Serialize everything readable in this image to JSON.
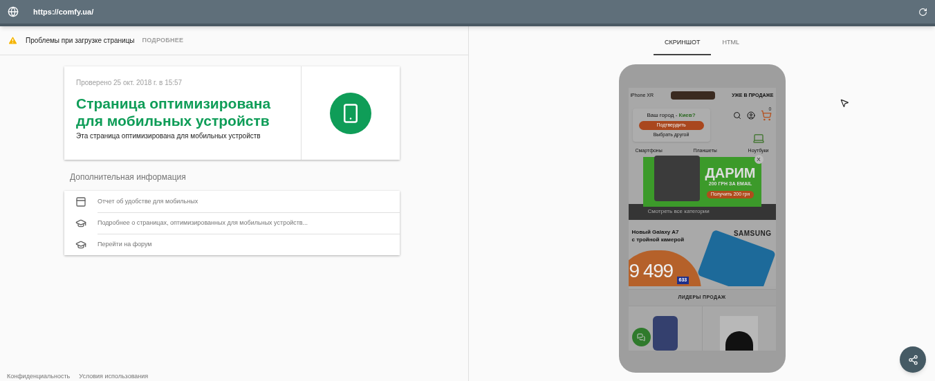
{
  "address_bar": {
    "url": "https://comfy.ua/"
  },
  "warning": {
    "text": "Проблемы при загрузке страницы",
    "link": "ПОДРОБНЕЕ"
  },
  "result_card": {
    "checked": "Проверено 25 окт. 2018 г. в 15:57",
    "title": "Страница оптимизирована для мобильных устройств",
    "description": "Эта страница оптимизирована для мобильных устройств"
  },
  "more_info": {
    "heading": "Дополнительная информация",
    "items": [
      {
        "kind": "report",
        "label": "Отчет об удобстве для мобильных"
      },
      {
        "kind": "learn",
        "label": "Подробнее о страницах, оптимизированных для мобильных устройств..."
      },
      {
        "kind": "learn",
        "label": "Перейти на форум"
      }
    ]
  },
  "footer_links": [
    "Конфиденциальность",
    "Условия использования"
  ],
  "tabs": [
    {
      "label": "СКРИНШОТ",
      "selected": true
    },
    {
      "label": "HTML",
      "selected": false
    }
  ],
  "phone_screen": {
    "promo_strip": {
      "model": "iPhone XR",
      "text": "УЖЕ В ПРОДАЖЕ"
    },
    "cart_count": "0",
    "categories": [
      "Смартфоны",
      "Планшеты",
      "Ноутбуки"
    ],
    "all_categories": "Смотреть все категории",
    "city_popup": {
      "question": "Ваш город - ",
      "city": "Киев?",
      "confirm": "Подтвердить",
      "other": "Выбрать другой"
    },
    "promo_popup": {
      "title": "ДАРИМ",
      "subtitle": "200 ГРН ЗА EMAIL",
      "button": "Получить 200 грн",
      "close": "X"
    },
    "banner": {
      "line_1": "Новый Galaxy A7",
      "line_2": "с тройной камерой",
      "brand": "SAMSUNG",
      "price": "9 499",
      "monthly": "633"
    },
    "section_title": "ЛИДЕРЫ ПРОДАЖ"
  }
}
